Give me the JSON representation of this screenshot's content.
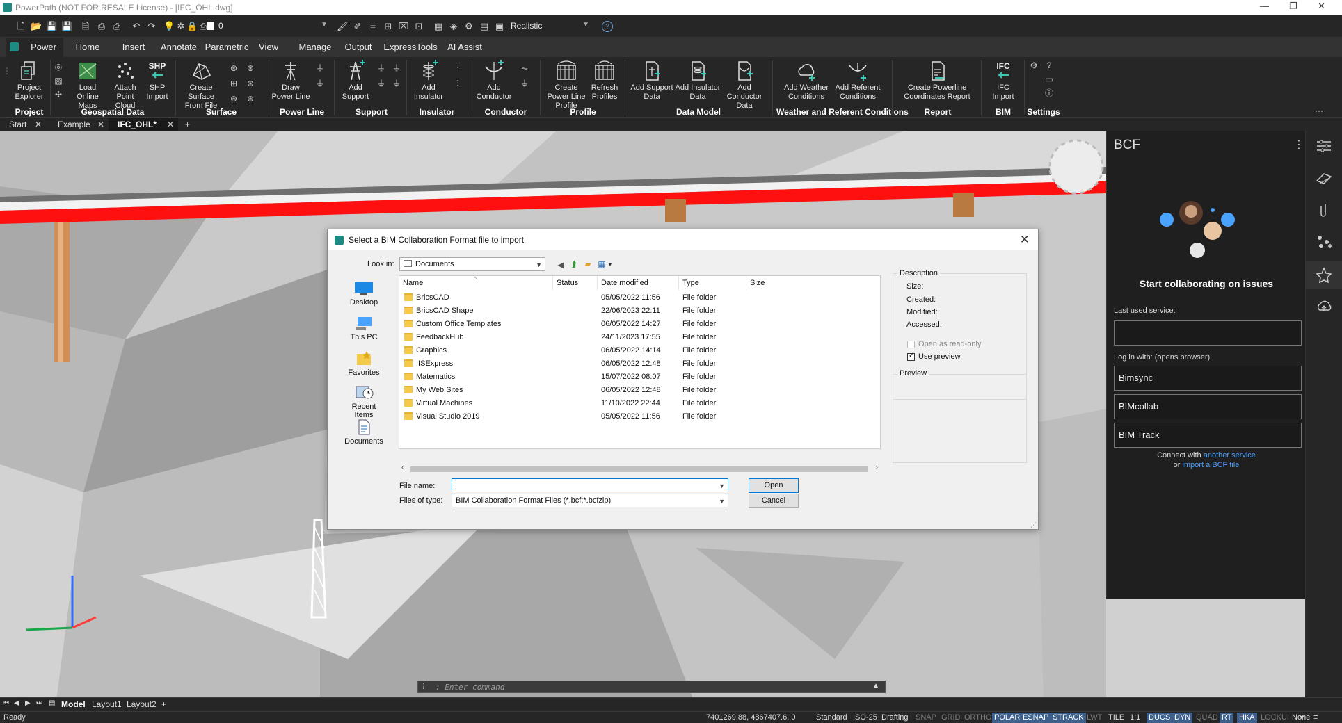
{
  "window": {
    "title": "PowerPath (NOT FOR RESALE License) - [IFC_OHL.dwg]"
  },
  "quick_access": {
    "layer_value": "0",
    "visual_style": "Realistic"
  },
  "menu_tabs": [
    "Power Path",
    "Home",
    "Insert",
    "Annotate",
    "Parametric",
    "View",
    "Manage",
    "Output",
    "ExpressTools",
    "AI Assist"
  ],
  "ribbon": {
    "buttons": {
      "project_explorer": "Project Explorer",
      "load_online_maps": "Load Online Maps",
      "attach_point_cloud": "Attach Point Cloud",
      "shp_import": "SHP Import",
      "create_surface": "Create Surface From File",
      "draw_power_line": "Draw Power Line",
      "add_support": "Add Support",
      "add_insulator": "Add Insulator",
      "add_conductor": "Add Conductor",
      "create_profile": "Create Power Line Profile",
      "refresh_profiles": "Refresh Profiles",
      "add_support_data": "Add Support Data",
      "add_insulator_data": "Add Insulator Data",
      "add_conductor_data": "Add Conductor Data",
      "add_weather": "Add Weather Conditions",
      "add_referent": "Add Referent Conditions",
      "create_report": "Create Powerline Coordinates Report",
      "ifc_import": "IFC Import",
      "shp_text": "SHP",
      "ifc_text": "IFC"
    },
    "groups": {
      "project": "Project",
      "geospatial": "Geospatial Data",
      "surface": "Surface",
      "power_line": "Power Line",
      "support": "Support",
      "insulator": "Insulator",
      "conductor": "Conductor",
      "profile": "Profile",
      "data_model": "Data Model",
      "weather": "Weather and Referent Conditions",
      "report": "Report",
      "bim": "BIM",
      "settings": "Settings"
    }
  },
  "doc_tabs": [
    "Start",
    "Example",
    "IFC_OHL*"
  ],
  "dialog": {
    "title": "Select a BIM Collaboration Format file to import",
    "look_in_label": "Look in:",
    "look_in_value": "Documents",
    "places": [
      "Desktop",
      "This PC",
      "Favorites",
      "Recent Items",
      "Documents"
    ],
    "columns": [
      "Name",
      "Status",
      "Date modified",
      "Type",
      "Size"
    ],
    "files": [
      {
        "name": "BricsCAD",
        "date": "05/05/2022 11:56",
        "type": "File folder"
      },
      {
        "name": "BricsCAD Shape",
        "date": "22/06/2023 22:11",
        "type": "File folder"
      },
      {
        "name": "Custom Office Templates",
        "date": "06/05/2022 14:27",
        "type": "File folder"
      },
      {
        "name": "FeedbackHub",
        "date": "24/11/2023 17:55",
        "type": "File folder"
      },
      {
        "name": "Graphics",
        "date": "06/05/2022 14:14",
        "type": "File folder"
      },
      {
        "name": "IISExpress",
        "date": "06/05/2022 12:48",
        "type": "File folder"
      },
      {
        "name": "Matematics",
        "date": "15/07/2022 08:07",
        "type": "File folder"
      },
      {
        "name": "My Web Sites",
        "date": "06/05/2022 12:48",
        "type": "File folder"
      },
      {
        "name": "Virtual Machines",
        "date": "11/10/2022 22:44",
        "type": "File folder"
      },
      {
        "name": "Visual Studio 2019",
        "date": "05/05/2022 11:56",
        "type": "File folder"
      }
    ],
    "file_name_label": "File name:",
    "file_name_value": "",
    "files_of_type_label": "Files of type:",
    "files_of_type_value": "BIM Collaboration Format Files (*.bcf;*.bcfzip)",
    "open_label": "Open",
    "cancel_label": "Cancel",
    "description": {
      "heading": "Description",
      "size": "Size:",
      "created": "Created:",
      "modified": "Modified:",
      "accessed": "Accessed:"
    },
    "open_read_only": "Open as read-only",
    "use_preview": "Use preview",
    "use_preview_checked": true,
    "preview_label": "Preview"
  },
  "bcf_panel": {
    "title": "BCF",
    "headline": "Start collaborating on issues",
    "last_used_label": "Last used service:",
    "login_label": "Log in with: (opens browser)",
    "services": [
      "Bimsync",
      "BIMcollab",
      "BIM Track"
    ],
    "connect_prefix": "Connect with",
    "another_service": "another service",
    "or_prefix": "or",
    "import_bcf": "import a BCF file",
    "link_color": "#4a9fff"
  },
  "command_line": {
    "placeholder": ": Enter command"
  },
  "layout_tabs": [
    "Model",
    "Layout1",
    "Layout2"
  ],
  "status": {
    "ready": "Ready",
    "coords": "7401269.88, 4867407.6, 0",
    "items": [
      {
        "label": "Standard",
        "state": "plain"
      },
      {
        "label": "ISO-25",
        "state": "plain"
      },
      {
        "label": "Drafting",
        "state": "plain"
      },
      {
        "label": "SNAP",
        "state": "off"
      },
      {
        "label": "GRID",
        "state": "off"
      },
      {
        "label": "ORTHO",
        "state": "off"
      },
      {
        "label": "POLAR",
        "state": "on"
      },
      {
        "label": "ESNAP",
        "state": "on"
      },
      {
        "label": "STRACK",
        "state": "on"
      },
      {
        "label": "LWT",
        "state": "off"
      },
      {
        "label": "TILE",
        "state": "plain"
      },
      {
        "label": "1:1",
        "state": "plain"
      },
      {
        "label": "DUCS",
        "state": "on"
      },
      {
        "label": "DYN",
        "state": "on"
      },
      {
        "label": "QUAD",
        "state": "off"
      },
      {
        "label": "RT",
        "state": "on"
      },
      {
        "label": "HKA",
        "state": "on"
      },
      {
        "label": "LOCKUI",
        "state": "off"
      },
      {
        "label": "None",
        "state": "plain"
      }
    ]
  },
  "colors": {
    "accent": "#1d8a83",
    "conductor_red": "#ff1010",
    "pole_orange": "#d28f55"
  }
}
